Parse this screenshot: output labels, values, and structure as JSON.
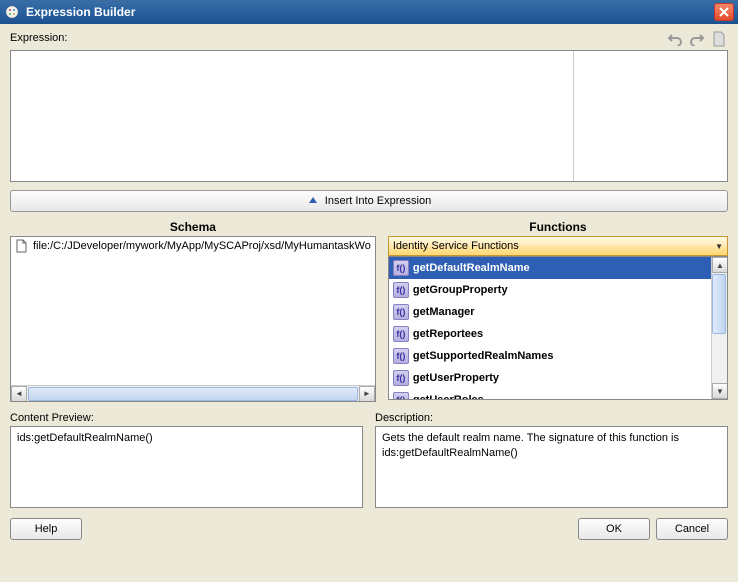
{
  "window": {
    "title": "Expression Builder"
  },
  "labels": {
    "expression": "Expression:",
    "insert_into_expression": "Insert Into Expression",
    "schema_header": "Schema",
    "functions_header": "Functions",
    "content_preview": "Content Preview:",
    "description": "Description:"
  },
  "schema": {
    "file_path": "file:/C:/JDeveloper/mywork/MyApp/MySCAProj/xsd/MyHumantaskWo"
  },
  "functions": {
    "category": "Identity Service Functions",
    "items": [
      {
        "name": "getDefaultRealmName",
        "selected": true
      },
      {
        "name": "getGroupProperty",
        "selected": false
      },
      {
        "name": "getManager",
        "selected": false
      },
      {
        "name": "getReportees",
        "selected": false
      },
      {
        "name": "getSupportedRealmNames",
        "selected": false
      },
      {
        "name": "getUserProperty",
        "selected": false
      },
      {
        "name": "getUserRoles",
        "selected": false
      }
    ],
    "icon_label": "f()"
  },
  "content_preview": {
    "text": "ids:getDefaultRealmName()"
  },
  "description": {
    "text": "Gets the default realm name. The signature of this function is ids:getDefaultRealmName()"
  },
  "buttons": {
    "help": "Help",
    "ok": "OK",
    "cancel": "Cancel"
  }
}
